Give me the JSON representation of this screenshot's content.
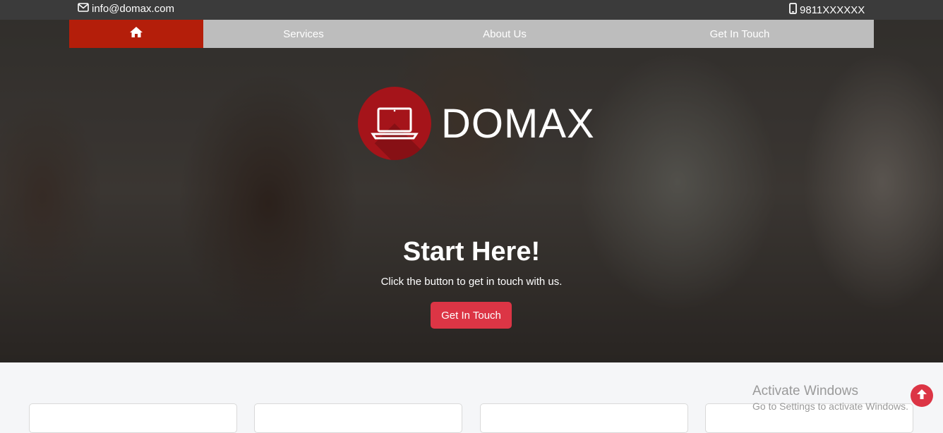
{
  "topbar": {
    "email": "info@domax.com",
    "email_icon": "envelope-icon",
    "phone": "9811XXXXXX",
    "phone_icon": "mobile-phone-icon"
  },
  "nav": {
    "home_icon": "home-icon",
    "items": [
      {
        "label": "Services"
      },
      {
        "label": "About Us"
      },
      {
        "label": "Get In Touch"
      }
    ],
    "home_bg": "#b41e0a",
    "bar_bg": "#bdbdbd"
  },
  "brand": {
    "name": "DOMAX",
    "logo_icon": "laptop-icon",
    "logo_color": "#a5141a"
  },
  "hero": {
    "title": "Start Here!",
    "subtitle": "Click the button to get in touch with us.",
    "button_label": "Get In Touch",
    "button_color": "#dc3545"
  },
  "watermark": {
    "line1": "Activate Windows",
    "line2": "Go to Settings to activate Windows."
  },
  "scroll_top_icon": "arrow-up-icon"
}
